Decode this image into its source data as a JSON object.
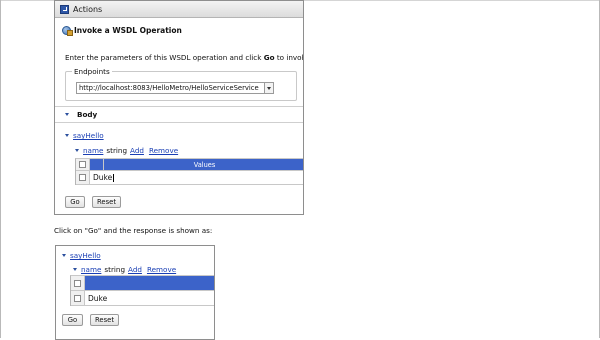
{
  "actions": {
    "title": "Actions"
  },
  "invoke": {
    "title": "Invoke a WSDL Operation",
    "instruction_prefix": "Enter the parameters of this WSDL operation and click ",
    "instruction_bold": "Go",
    "instruction_suffix": " to invoke."
  },
  "endpoints": {
    "legend": "Endpoints",
    "selected": "http://localhost:8083/HelloMetro/HelloServiceService"
  },
  "body_section": {
    "label": "Body"
  },
  "operation": {
    "name": "sayHello",
    "param_name": "name",
    "param_type": "string",
    "add": "Add",
    "remove": "Remove",
    "values_header": "Values",
    "value": "Duke"
  },
  "buttons": {
    "go": "Go",
    "reset": "Reset"
  },
  "caption": "Click on \"Go\" and the response is shown as:",
  "response": {
    "operation": "sayHello",
    "param_name": "name",
    "param_type": "string",
    "add": "Add",
    "remove": "Remove",
    "value": "Duke",
    "go": "Go",
    "reset": "Reset"
  }
}
